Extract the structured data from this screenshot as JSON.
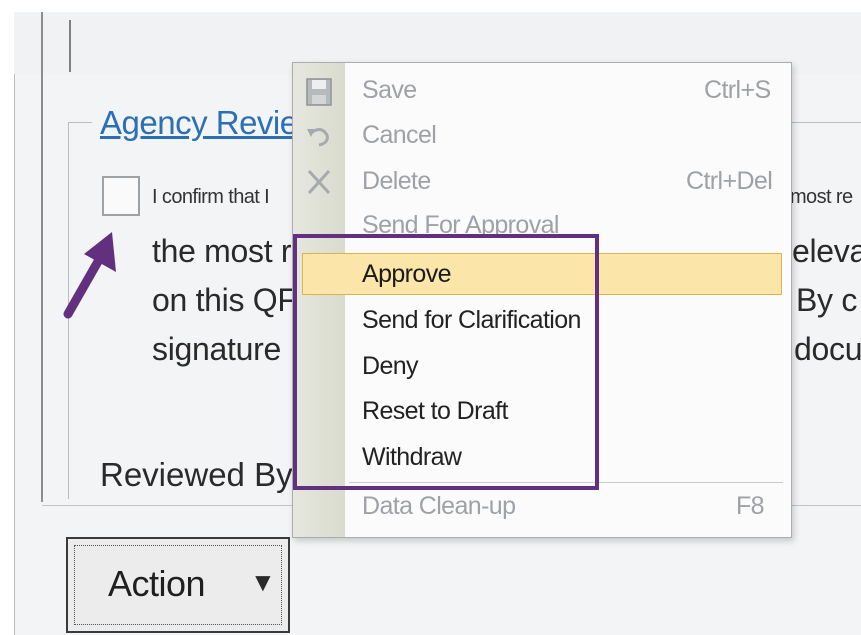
{
  "section": {
    "legend": "Agency Revie",
    "confirm_text_left": "I confirm that I",
    "confirm_text_right": "most re",
    "big_lines_left": [
      "the most r",
      "on this QF",
      "signature"
    ],
    "big_lines_right": [
      "eleva",
      "By c",
      "docu"
    ],
    "reviewed_by_label": "Reviewed By"
  },
  "action_button": {
    "label": "Action",
    "arrow": "▼"
  },
  "menu": {
    "items": [
      {
        "label": "Save",
        "shortcut": "Ctrl+S",
        "icon": "save-icon",
        "enabled": false
      },
      {
        "label": "Cancel",
        "shortcut": "",
        "icon": "undo-icon",
        "enabled": false
      },
      {
        "label": "Delete",
        "shortcut": "Ctrl+Del",
        "icon": "delete-x-icon",
        "enabled": false
      },
      {
        "label": "Send For Approval",
        "shortcut": "",
        "icon": "",
        "enabled": false
      },
      {
        "label": "Approve",
        "shortcut": "",
        "icon": "",
        "enabled": true,
        "highlighted": true
      },
      {
        "label": "Send for Clarification",
        "shortcut": "",
        "icon": "",
        "enabled": true
      },
      {
        "label": "Deny",
        "shortcut": "",
        "icon": "",
        "enabled": true
      },
      {
        "label": "Reset to Draft",
        "shortcut": "",
        "icon": "",
        "enabled": true
      },
      {
        "label": "Withdraw",
        "shortcut": "",
        "icon": "",
        "enabled": true
      },
      {
        "label": "Data Clean-up",
        "shortcut": "F8",
        "icon": "",
        "enabled": false
      }
    ]
  },
  "colors": {
    "annotation_purple": "#63307f",
    "link_blue": "#2b6fb5",
    "highlight": "#fbe5a8"
  }
}
